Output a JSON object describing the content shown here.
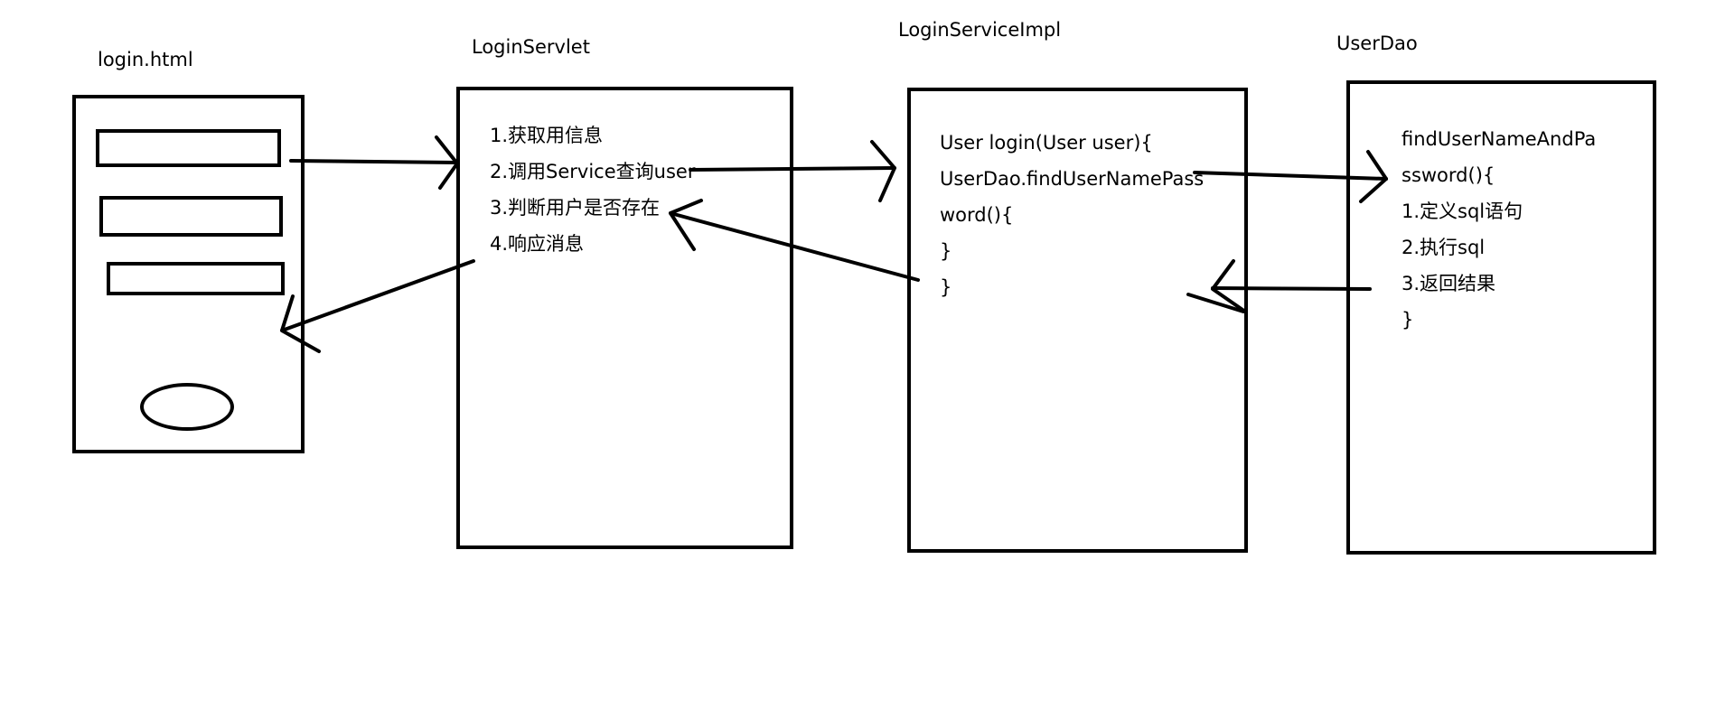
{
  "components": {
    "login_html": {
      "title": "login.html"
    },
    "login_servlet": {
      "title": "LoginServlet",
      "lines": [
        "1.获取用信息",
        "2.调用Service查询user",
        "3.判断用户是否存在",
        "4.响应消息"
      ]
    },
    "login_service_impl": {
      "title": "LoginServiceImpl",
      "lines": [
        "User login(User user){",
        "UserDao.findUserNamePass",
        "word(){",
        "}",
        "}"
      ]
    },
    "user_dao": {
      "title": "UserDao",
      "lines": [
        "findUserNameAndPa",
        "ssword(){",
        "1.定义sql语句",
        "2.执行sql",
        "3.返回结果",
        "}"
      ]
    }
  }
}
